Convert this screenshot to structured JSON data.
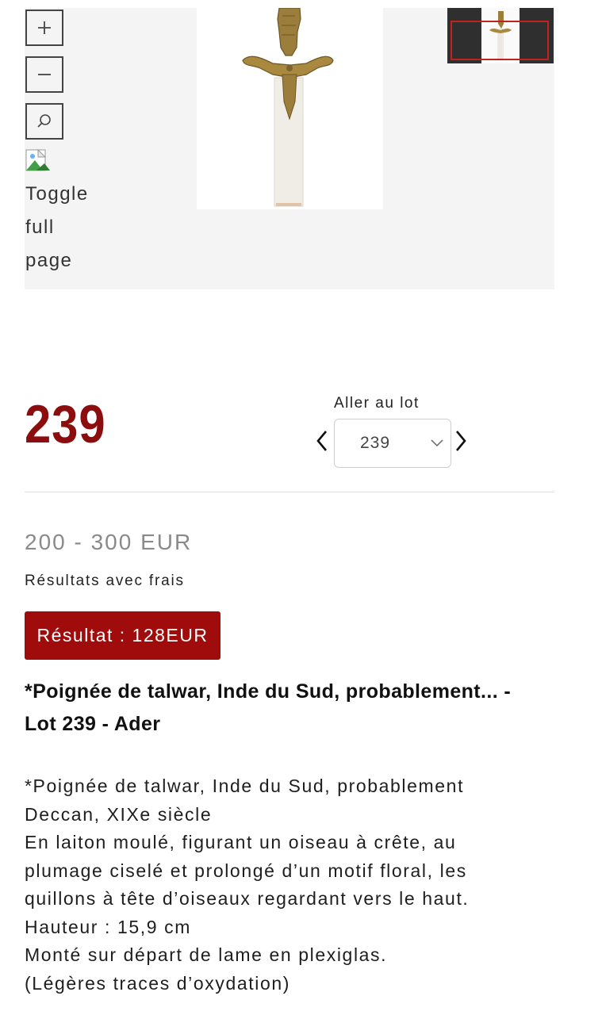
{
  "viewer": {
    "zoom_in_icon": "plus-icon",
    "zoom_out_icon": "minus-icon",
    "search_icon": "search-icon",
    "toggle_lines": [
      "Toggle",
      "full",
      "page"
    ]
  },
  "lot": {
    "number": "239",
    "goto_label": "Aller au lot",
    "selected_lot": "239"
  },
  "estimate": "200 - 300 EUR",
  "fees_label": "Résultats avec frais",
  "result_label": "Résultat : 128EUR",
  "title_lines": [
    "*Poignée de talwar, Inde du Sud, probablement... -",
    "Lot 239 - Ader"
  ],
  "description_lines": [
    "*Poignée de talwar, Inde du Sud, probablement",
    "Deccan, XIXe siècle",
    "En laiton moulé, figurant un oiseau à crête, au",
    "plumage ciselé et prolongé d’un motif floral, les",
    "quillons à tête d’oiseaux regardant vers le haut.",
    "Hauteur : 15,9 cm",
    "Monté sur départ de lame en plexiglas.",
    "(Légères traces d’oxydation)"
  ],
  "colors": {
    "accent": "#8c0d0d",
    "badge": "#a00c0c",
    "thumb_frame": "#c0231d"
  }
}
